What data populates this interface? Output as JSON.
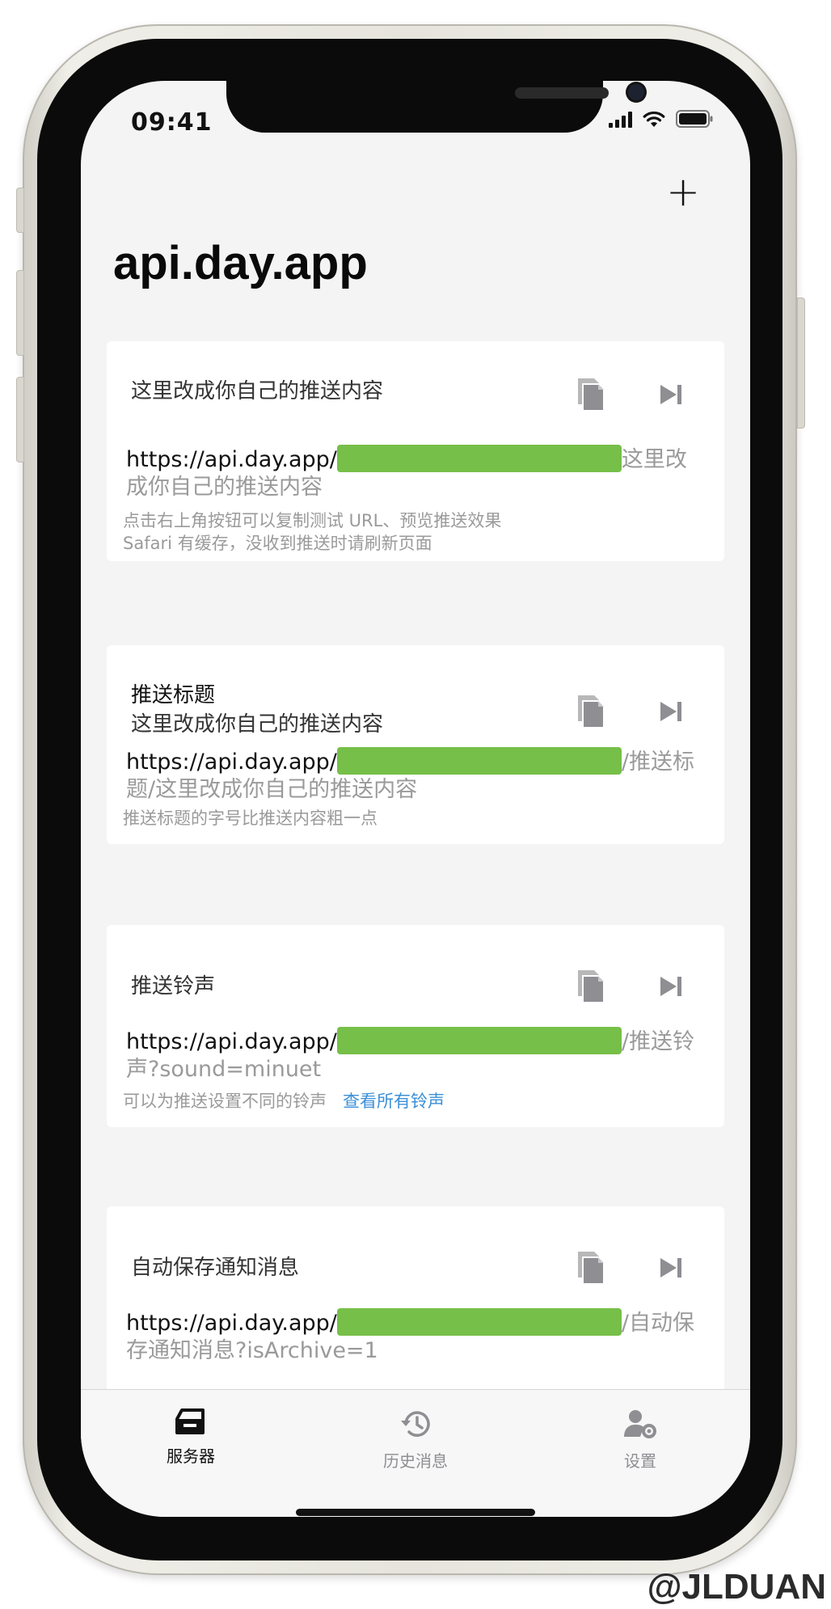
{
  "status_bar": {
    "time": "09:41"
  },
  "header": {
    "add_label": "+",
    "title": "api.day.app"
  },
  "cards": [
    {
      "message_lines": [
        "这里改成你自己的推送内容"
      ],
      "url_base": "https://api.day.app/",
      "url_suffix": "这里改成你自己的推送内容",
      "notes": [
        "点击右上角按钮可以复制测试 URL、预览推送效果",
        "Safari 有缓存，没收到推送时请刷新页面"
      ]
    },
    {
      "message_lines": [
        "推送标题",
        "这里改成你自己的推送内容"
      ],
      "url_base": "https://api.day.app/",
      "url_suffix": "/推送标题/这里改成你自己的推送内容",
      "notes": [
        "推送标题的字号比推送内容粗一点"
      ]
    },
    {
      "message_lines": [
        "推送铃声"
      ],
      "url_base": "https://api.day.app/",
      "url_suffix": "/推送铃声?sound=minuet",
      "notes": [
        "可以为推送设置不同的铃声"
      ],
      "link_label": "查看所有铃声"
    },
    {
      "message_lines": [
        "自动保存通知消息"
      ],
      "url_base": "https://api.day.app/",
      "url_suffix": "/自动保存通知消息?isArchive=1"
    }
  ],
  "tabbar": {
    "tabs": [
      {
        "label": "服务器",
        "icon": "server-icon",
        "active": true
      },
      {
        "label": "历史消息",
        "icon": "history-icon",
        "active": false
      },
      {
        "label": "设置",
        "icon": "settings-icon",
        "active": false
      }
    ]
  },
  "watermark": "@JLDUAN",
  "colors": {
    "redaction": "#76bf48",
    "link": "#3b8fd8",
    "icon_gray": "#8e8e93"
  }
}
